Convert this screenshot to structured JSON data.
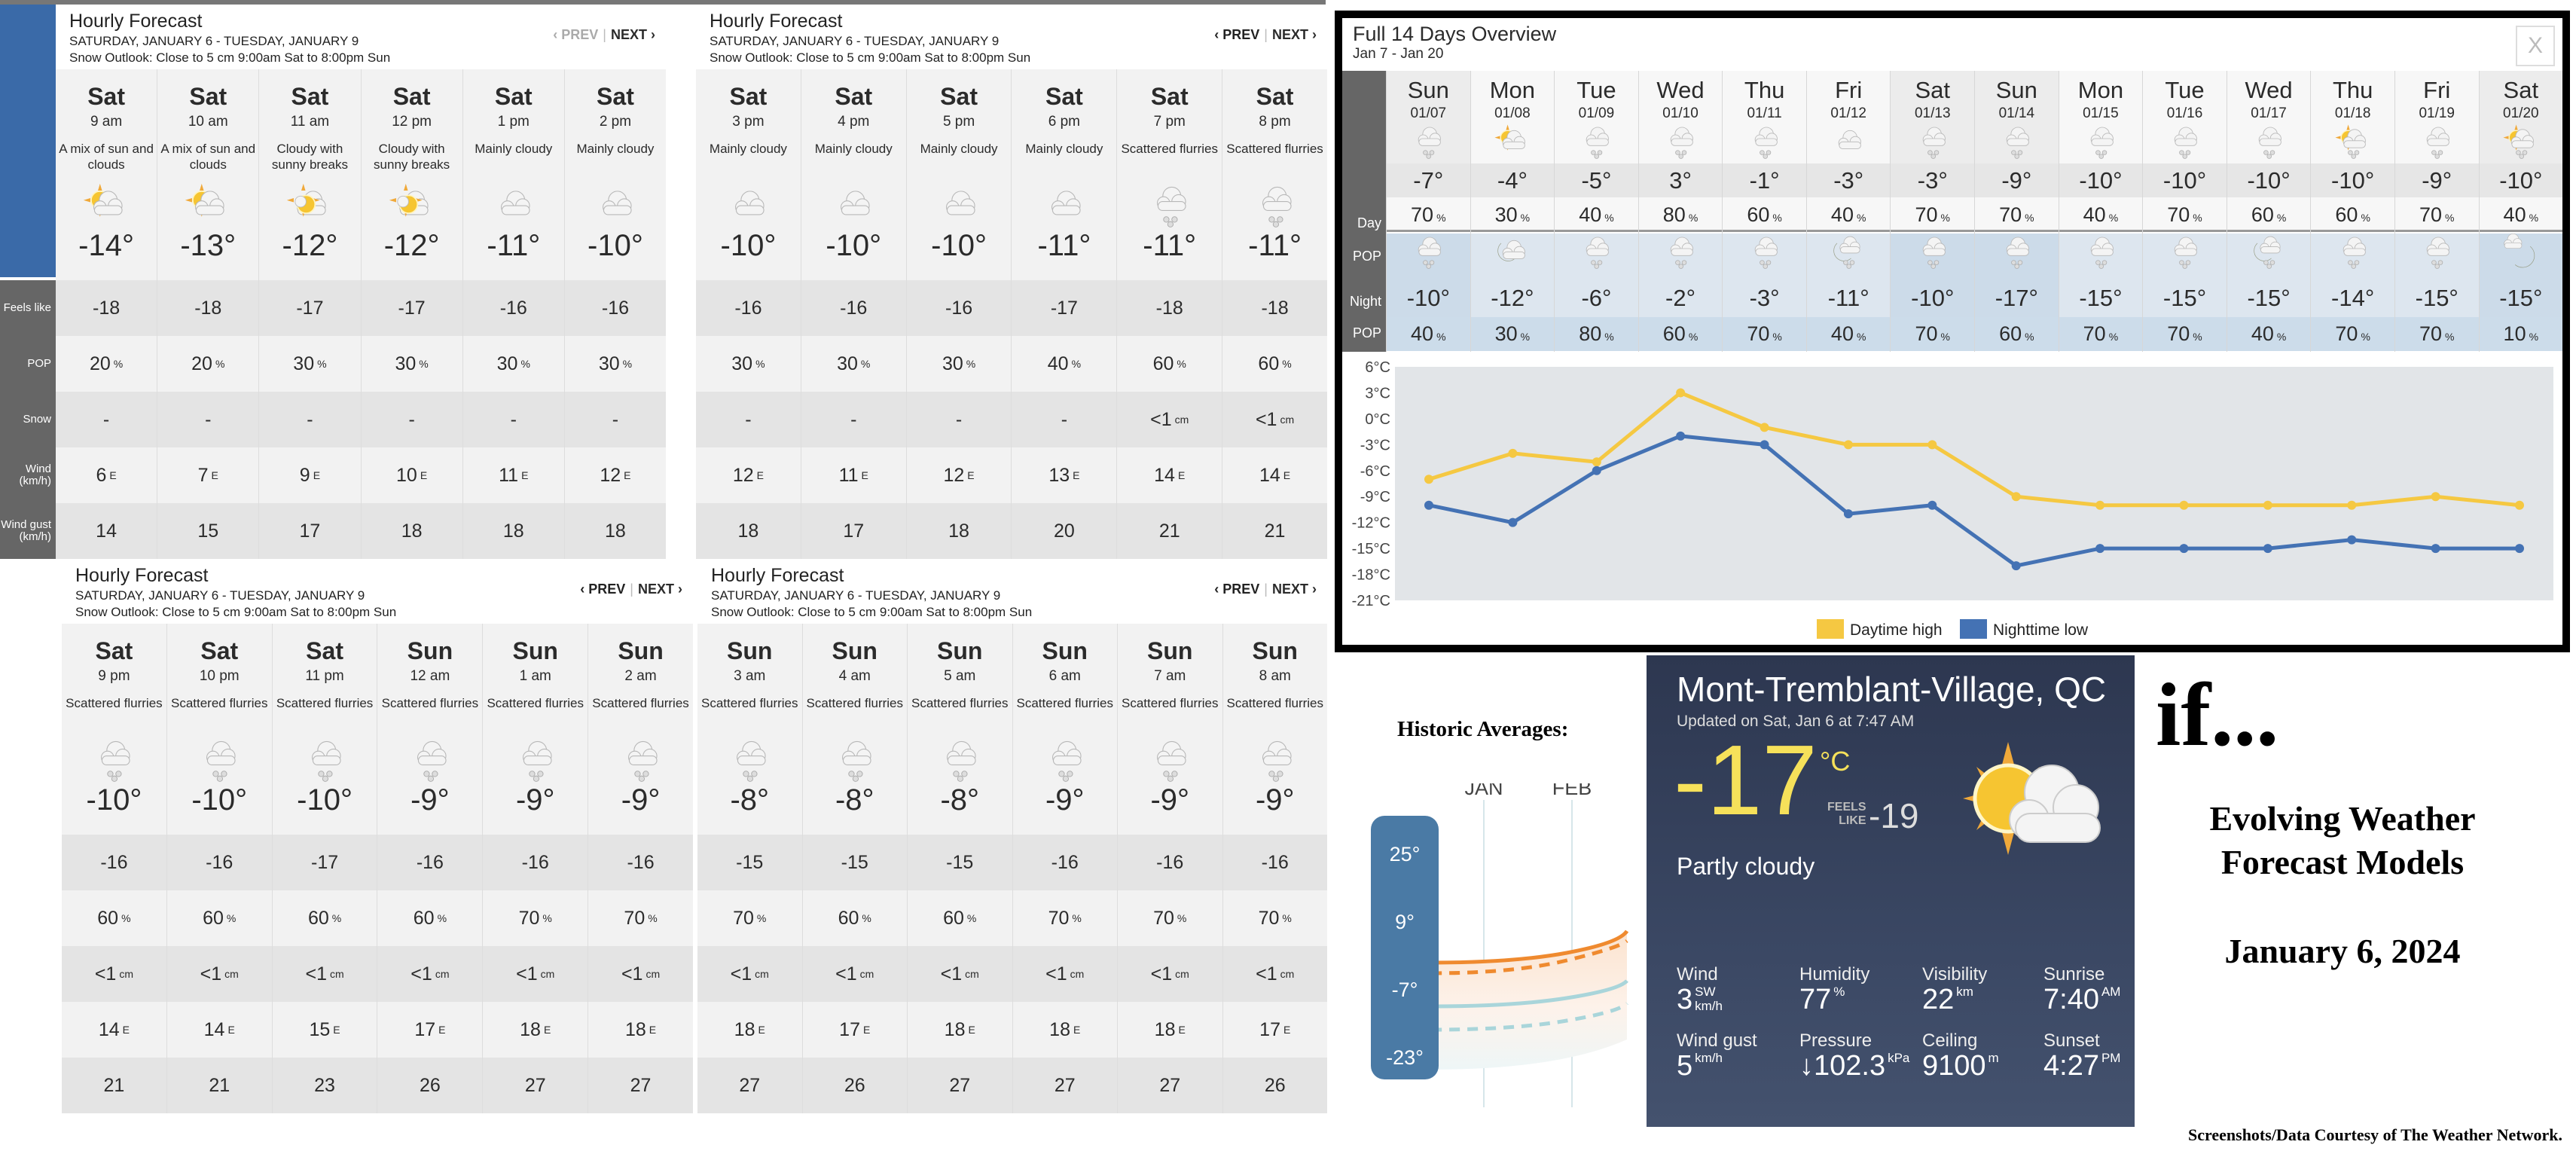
{
  "hourly_panel_common": {
    "title": "Hourly Forecast",
    "range": "SATURDAY, JANUARY 6 - TUESDAY, JANUARY 9",
    "snow_outlook": "Snow Outlook: Close to 5 cm 9:00am Sat to 8:00pm Sun",
    "prev": "‹ PREV",
    "sep": "|",
    "next": "NEXT ›"
  },
  "row_labels": [
    "Feels like",
    "POP",
    "Snow",
    "Wind\n(km/h)",
    "Wind gust\n(km/h)"
  ],
  "hourly_panels": [
    {
      "prev_enabled": false,
      "hours": [
        {
          "day": "Sat",
          "time": "9 am",
          "cond": "A mix of sun and clouds",
          "icon": "sun-cloud",
          "temp": "-14°",
          "feels": "-18",
          "pop": "20",
          "snow": "-",
          "wind": "6",
          "dir": "E",
          "gust": "14"
        },
        {
          "day": "Sat",
          "time": "10 am",
          "cond": "A mix of sun and clouds",
          "icon": "sun-cloud",
          "temp": "-13°",
          "feels": "-18",
          "pop": "20",
          "snow": "-",
          "wind": "7",
          "dir": "E",
          "gust": "15"
        },
        {
          "day": "Sat",
          "time": "11 am",
          "cond": "Cloudy with sunny breaks",
          "icon": "cloud-sun",
          "temp": "-12°",
          "feels": "-17",
          "pop": "30",
          "snow": "-",
          "wind": "9",
          "dir": "E",
          "gust": "17"
        },
        {
          "day": "Sat",
          "time": "12 pm",
          "cond": "Cloudy with sunny breaks",
          "icon": "cloud-sun",
          "temp": "-12°",
          "feels": "-17",
          "pop": "30",
          "snow": "-",
          "wind": "10",
          "dir": "E",
          "gust": "18"
        },
        {
          "day": "Sat",
          "time": "1 pm",
          "cond": "Mainly cloudy",
          "icon": "cloud",
          "temp": "-11°",
          "feels": "-16",
          "pop": "30",
          "snow": "-",
          "wind": "11",
          "dir": "E",
          "gust": "18"
        },
        {
          "day": "Sat",
          "time": "2 pm",
          "cond": "Mainly cloudy",
          "icon": "cloud",
          "temp": "-10°",
          "feels": "-16",
          "pop": "30",
          "snow": "-",
          "wind": "12",
          "dir": "E",
          "gust": "18"
        }
      ]
    },
    {
      "prev_enabled": true,
      "hours": [
        {
          "day": "Sat",
          "time": "3 pm",
          "cond": "Mainly cloudy",
          "icon": "cloud",
          "temp": "-10°",
          "feels": "-16",
          "pop": "30",
          "snow": "-",
          "wind": "12",
          "dir": "E",
          "gust": "18"
        },
        {
          "day": "Sat",
          "time": "4 pm",
          "cond": "Mainly cloudy",
          "icon": "cloud",
          "temp": "-10°",
          "feels": "-16",
          "pop": "30",
          "snow": "-",
          "wind": "11",
          "dir": "E",
          "gust": "17"
        },
        {
          "day": "Sat",
          "time": "5 pm",
          "cond": "Mainly cloudy",
          "icon": "cloud",
          "temp": "-10°",
          "feels": "-16",
          "pop": "30",
          "snow": "-",
          "wind": "12",
          "dir": "E",
          "gust": "18"
        },
        {
          "day": "Sat",
          "time": "6 pm",
          "cond": "Mainly cloudy",
          "icon": "cloud",
          "temp": "-11°",
          "feels": "-17",
          "pop": "40",
          "snow": "-",
          "wind": "13",
          "dir": "E",
          "gust": "20"
        },
        {
          "day": "Sat",
          "time": "7 pm",
          "cond": "Scattered flurries",
          "icon": "snow",
          "temp": "-11°",
          "feels": "-18",
          "pop": "60",
          "snow": "<1",
          "wind": "14",
          "dir": "E",
          "gust": "21"
        },
        {
          "day": "Sat",
          "time": "8 pm",
          "cond": "Scattered flurries",
          "icon": "snow",
          "temp": "-11°",
          "feels": "-18",
          "pop": "60",
          "snow": "<1",
          "wind": "14",
          "dir": "E",
          "gust": "21"
        }
      ]
    },
    {
      "prev_enabled": true,
      "hours": [
        {
          "day": "Sat",
          "time": "9 pm",
          "cond": "Scattered flurries",
          "icon": "snow",
          "temp": "-10°",
          "feels": "-16",
          "pop": "60",
          "snow": "<1",
          "wind": "14",
          "dir": "E",
          "gust": "21"
        },
        {
          "day": "Sat",
          "time": "10 pm",
          "cond": "Scattered flurries",
          "icon": "snow",
          "temp": "-10°",
          "feels": "-16",
          "pop": "60",
          "snow": "<1",
          "wind": "14",
          "dir": "E",
          "gust": "21"
        },
        {
          "day": "Sat",
          "time": "11 pm",
          "cond": "Scattered flurries",
          "icon": "snow",
          "temp": "-10°",
          "feels": "-17",
          "pop": "60",
          "snow": "<1",
          "wind": "15",
          "dir": "E",
          "gust": "23"
        },
        {
          "day": "Sun",
          "time": "12 am",
          "cond": "Scattered flurries",
          "icon": "snow",
          "temp": "-9°",
          "feels": "-16",
          "pop": "60",
          "snow": "<1",
          "wind": "17",
          "dir": "E",
          "gust": "26"
        },
        {
          "day": "Sun",
          "time": "1 am",
          "cond": "Scattered flurries",
          "icon": "snow",
          "temp": "-9°",
          "feels": "-16",
          "pop": "70",
          "snow": "<1",
          "wind": "18",
          "dir": "E",
          "gust": "27"
        },
        {
          "day": "Sun",
          "time": "2 am",
          "cond": "Scattered flurries",
          "icon": "snow",
          "temp": "-9°",
          "feels": "-16",
          "pop": "70",
          "snow": "<1",
          "wind": "18",
          "dir": "E",
          "gust": "27"
        }
      ]
    },
    {
      "prev_enabled": true,
      "hours": [
        {
          "day": "Sun",
          "time": "3 am",
          "cond": "Scattered flurries",
          "icon": "snow",
          "temp": "-8°",
          "feels": "-15",
          "pop": "70",
          "snow": "<1",
          "wind": "18",
          "dir": "E",
          "gust": "27"
        },
        {
          "day": "Sun",
          "time": "4 am",
          "cond": "Scattered flurries",
          "icon": "snow",
          "temp": "-8°",
          "feels": "-15",
          "pop": "60",
          "snow": "<1",
          "wind": "17",
          "dir": "E",
          "gust": "26"
        },
        {
          "day": "Sun",
          "time": "5 am",
          "cond": "Scattered flurries",
          "icon": "snow",
          "temp": "-8°",
          "feels": "-15",
          "pop": "60",
          "snow": "<1",
          "wind": "18",
          "dir": "E",
          "gust": "27"
        },
        {
          "day": "Sun",
          "time": "6 am",
          "cond": "Scattered flurries",
          "icon": "snow",
          "temp": "-9°",
          "feels": "-16",
          "pop": "70",
          "snow": "<1",
          "wind": "18",
          "dir": "E",
          "gust": "27"
        },
        {
          "day": "Sun",
          "time": "7 am",
          "cond": "Scattered flurries",
          "icon": "snow",
          "temp": "-9°",
          "feels": "-16",
          "pop": "70",
          "snow": "<1",
          "wind": "18",
          "dir": "E",
          "gust": "27"
        },
        {
          "day": "Sun",
          "time": "8 am",
          "cond": "Scattered flurries",
          "icon": "snow",
          "temp": "-9°",
          "feels": "-16",
          "pop": "70",
          "snow": "<1",
          "wind": "17",
          "dir": "E",
          "gust": "26"
        }
      ]
    }
  ],
  "units": {
    "pop": "%",
    "snow": "cm"
  },
  "overview": {
    "title": "Full 14 Days Overview",
    "range": "Jan 7 - Jan 20",
    "close": "X",
    "labels": {
      "day": "Day",
      "pop": "POP",
      "night": "Night"
    },
    "days": [
      {
        "name": "Sun",
        "date": "01/07",
        "day_icon": "snow",
        "hi": "-7°",
        "day_pop": "70",
        "night_icon": "snow",
        "lo": "-10°",
        "night_pop": "40"
      },
      {
        "name": "Mon",
        "date": "01/08",
        "day_icon": "sun-cloud",
        "hi": "-4°",
        "day_pop": "30",
        "night_icon": "moon-cloud",
        "lo": "-12°",
        "night_pop": "30"
      },
      {
        "name": "Tue",
        "date": "01/09",
        "day_icon": "snow",
        "hi": "-5°",
        "day_pop": "40",
        "night_icon": "snow",
        "lo": "-6°",
        "night_pop": "80"
      },
      {
        "name": "Wed",
        "date": "01/10",
        "day_icon": "snow",
        "hi": "3°",
        "day_pop": "80",
        "night_icon": "snow",
        "lo": "-2°",
        "night_pop": "60"
      },
      {
        "name": "Thu",
        "date": "01/11",
        "day_icon": "snow",
        "hi": "-1°",
        "day_pop": "60",
        "night_icon": "snow",
        "lo": "-3°",
        "night_pop": "70"
      },
      {
        "name": "Fri",
        "date": "01/12",
        "day_icon": "cloud",
        "hi": "-3°",
        "day_pop": "40",
        "night_icon": "moon-snow",
        "lo": "-11°",
        "night_pop": "40"
      },
      {
        "name": "Sat",
        "date": "01/13",
        "day_icon": "snow",
        "hi": "-3°",
        "day_pop": "70",
        "night_icon": "snow",
        "lo": "-10°",
        "night_pop": "70"
      },
      {
        "name": "Sun",
        "date": "01/14",
        "day_icon": "snow",
        "hi": "-9°",
        "day_pop": "70",
        "night_icon": "snow",
        "lo": "-17°",
        "night_pop": "60"
      },
      {
        "name": "Mon",
        "date": "01/15",
        "day_icon": "snow",
        "hi": "-10°",
        "day_pop": "40",
        "night_icon": "snow",
        "lo": "-15°",
        "night_pop": "70"
      },
      {
        "name": "Tue",
        "date": "01/16",
        "day_icon": "snow",
        "hi": "-10°",
        "day_pop": "70",
        "night_icon": "snow",
        "lo": "-15°",
        "night_pop": "70"
      },
      {
        "name": "Wed",
        "date": "01/17",
        "day_icon": "snow",
        "hi": "-10°",
        "day_pop": "60",
        "night_icon": "moon-snow",
        "lo": "-15°",
        "night_pop": "40"
      },
      {
        "name": "Thu",
        "date": "01/18",
        "day_icon": "sun-snow",
        "hi": "-10°",
        "day_pop": "60",
        "night_icon": "snow",
        "lo": "-14°",
        "night_pop": "70"
      },
      {
        "name": "Fri",
        "date": "01/19",
        "day_icon": "snow",
        "hi": "-9°",
        "day_pop": "70",
        "night_icon": "snow",
        "lo": "-15°",
        "night_pop": "70"
      },
      {
        "name": "Sat",
        "date": "01/20",
        "day_icon": "sun-snow",
        "hi": "-10°",
        "day_pop": "40",
        "night_icon": "cloud-moon",
        "lo": "-15°",
        "night_pop": "10"
      }
    ]
  },
  "chart_data": {
    "type": "line",
    "title": "",
    "x": [
      "01/07",
      "01/08",
      "01/09",
      "01/10",
      "01/11",
      "01/12",
      "01/13",
      "01/14",
      "01/15",
      "01/16",
      "01/17",
      "01/18",
      "01/19",
      "01/20"
    ],
    "series": [
      {
        "name": "Daytime high",
        "color": "#f5c842",
        "values": [
          -7,
          -4,
          -5,
          3,
          -1,
          -3,
          -3,
          -9,
          -10,
          -10,
          -10,
          -10,
          -9,
          -10
        ]
      },
      {
        "name": "Nighttime low",
        "color": "#4472b4",
        "values": [
          -10,
          -12,
          -6,
          -2,
          -3,
          -11,
          -10,
          -17,
          -15,
          -15,
          -15,
          -14,
          -15,
          -15
        ]
      }
    ],
    "yticks": [
      "6°C",
      "3°C",
      "0°C",
      "-3°C",
      "-6°C",
      "-9°C",
      "-12°C",
      "-15°C",
      "-18°C",
      "-21°C"
    ],
    "ylim": [
      -21,
      6
    ],
    "grid": false,
    "legend": "bottom-center"
  },
  "historic": {
    "title": "Historic Averages:",
    "months": [
      "JAN",
      "FEB"
    ],
    "scale": [
      "25°",
      "9°",
      "-7°",
      "-23°"
    ],
    "colors": {
      "high": "#ef8a2f",
      "low": "#8fc8d0",
      "scale": "#4a7aa5"
    }
  },
  "current": {
    "location": "Mont-Tremblant-Village, QC",
    "updated": "Updated on Sat, Jan 6 at 7:47 AM",
    "temp": "-17",
    "temp_unit": "°C",
    "feels_label_1": "FEELS",
    "feels_label_2": "LIKE",
    "feels": "-19",
    "condition": "Partly cloudy",
    "icon": "sun-cloud",
    "details": [
      {
        "label": "Wind",
        "value": "3",
        "sup": "SW",
        "sub": "km/h"
      },
      {
        "label": "Humidity",
        "value": "77",
        "sup": "%",
        "sub": ""
      },
      {
        "label": "Visibility",
        "value": "22",
        "sup": "km",
        "sub": ""
      },
      {
        "label": "Sunrise",
        "value": "7:40",
        "sup": "AM",
        "sub": ""
      },
      {
        "label": "Wind gust",
        "value": "5",
        "sup": "km/h",
        "sub": ""
      },
      {
        "label": "Pressure",
        "value": "↓102.3",
        "sup": "kPa",
        "sub": ""
      },
      {
        "label": "Ceiling",
        "value": "9100",
        "sup": "m",
        "sub": ""
      },
      {
        "label": "Sunset",
        "value": "4:27",
        "sup": "PM",
        "sub": ""
      }
    ]
  },
  "title_block": {
    "if": "if...",
    "heading_1": "Evolving Weather",
    "heading_2": "Forecast Models",
    "date": "January 6, 2024",
    "credit": "Screenshots/Data Courtesy of The Weather Network."
  }
}
